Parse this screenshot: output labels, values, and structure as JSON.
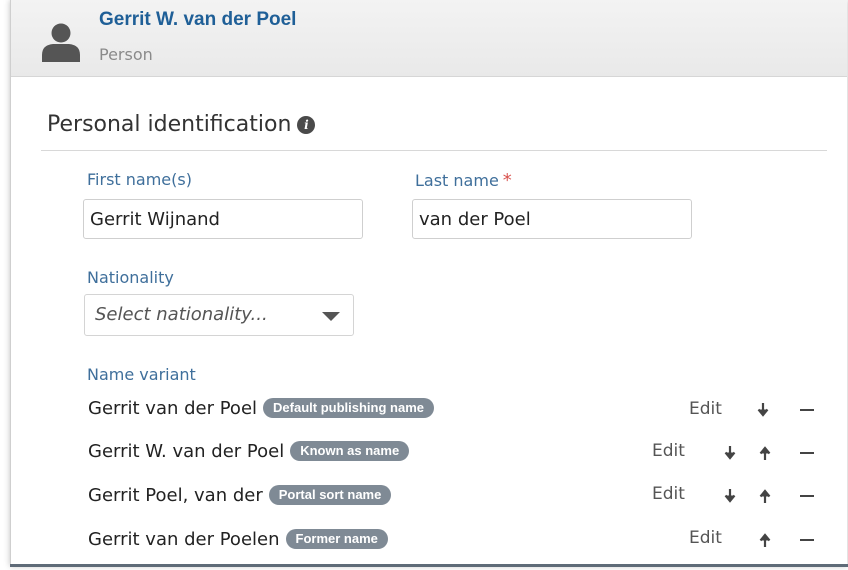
{
  "header": {
    "name": "Gerrit W. van der Poel",
    "type": "Person"
  },
  "section": {
    "title": "Personal identification",
    "info_icon": "info-icon"
  },
  "fields": {
    "first_name": {
      "label": "First name(s)",
      "value": "Gerrit Wijnand"
    },
    "last_name": {
      "label": "Last name",
      "required_mark": "*",
      "value": "van der Poel"
    },
    "nationality": {
      "label": "Nationality",
      "placeholder": "Select nationality..."
    }
  },
  "name_variant": {
    "label": "Name variant",
    "edit_label": "Edit",
    "items": [
      {
        "name": "Gerrit van der Poel",
        "badge": "Default publishing name"
      },
      {
        "name": "Gerrit W. van der Poel",
        "badge": "Known as name"
      },
      {
        "name": "Gerrit Poel, van der",
        "badge": "Portal sort name"
      },
      {
        "name": "Gerrit van der Poelen",
        "badge": "Former name"
      }
    ]
  },
  "colors": {
    "link": "#1f5f97",
    "label": "#3f6f9b",
    "badge": "#7f8a95",
    "required": "#d9534f"
  }
}
